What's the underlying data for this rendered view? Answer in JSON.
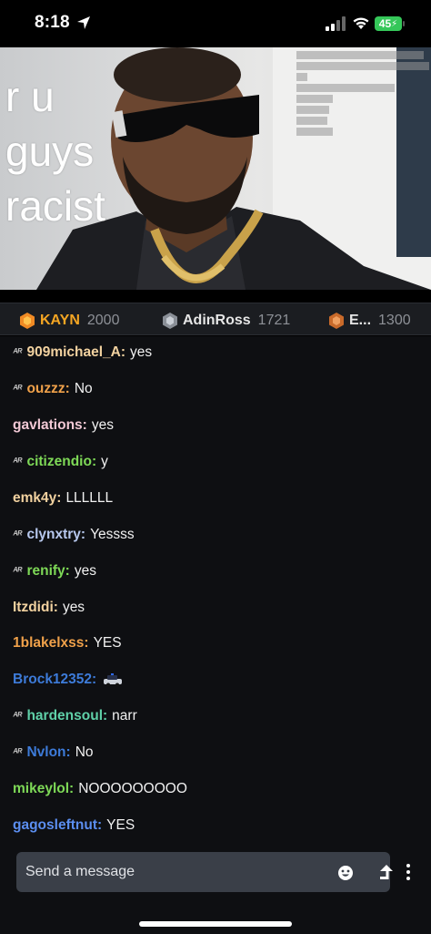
{
  "status_bar": {
    "time": "8:18",
    "battery": "45"
  },
  "stream": {
    "caption": "r u\nguys\nracist"
  },
  "leaderboard": [
    {
      "name": "KAYN",
      "score": "2000",
      "color": "#f5a623",
      "icon": "gold-gem-icon"
    },
    {
      "name": "AdinRoss",
      "score": "1721",
      "color": "#e6e6e6",
      "icon": "silver-gem-icon"
    },
    {
      "name": "E...",
      "score": "1300",
      "color": "#e6e6e6",
      "icon": "bronze-gem-icon"
    }
  ],
  "chat": {
    "messages": [
      {
        "badge": true,
        "username": "909michael_A:",
        "message": "yes",
        "color": "#f2d2a0"
      },
      {
        "badge": true,
        "username": "ouzzz:",
        "message": "No",
        "color": "#f0a14a"
      },
      {
        "badge": false,
        "username": "gavlations:",
        "message": "yes",
        "color": "#f1c8d4"
      },
      {
        "badge": true,
        "username": "citizendio:",
        "message": "y",
        "color": "#7ed957"
      },
      {
        "badge": false,
        "username": "emk4y:",
        "message": "LLLLLL",
        "color": "#f2d2a0"
      },
      {
        "badge": true,
        "username": "clynxtry:",
        "message": "Yessss",
        "color": "#b7c8ee"
      },
      {
        "badge": true,
        "username": "renify:",
        "message": "yes",
        "color": "#7ed957"
      },
      {
        "badge": false,
        "username": "Itzdidi:",
        "message": "yes",
        "color": "#f2d2a0"
      },
      {
        "badge": false,
        "username": "1blakelxss:",
        "message": "YES",
        "color": "#f0a14a"
      },
      {
        "badge": false,
        "username": "Brock12352:",
        "message": "",
        "color": "#3d7bd9",
        "emote": true
      },
      {
        "badge": true,
        "username": "hardensoul:",
        "message": "narr",
        "color": "#5fd0a8"
      },
      {
        "badge": true,
        "username": "Nvlon:",
        "message": "No",
        "color": "#3d7bd9"
      },
      {
        "badge": false,
        "username": "mikeylol:",
        "message": "NOOOOOOOOO",
        "color": "#7ed957"
      },
      {
        "badge": false,
        "username": "gagosleftnut:",
        "message": "YES",
        "color": "#5b8ef0"
      }
    ],
    "badge_text": "ᴬᴿ"
  },
  "input": {
    "placeholder": "Send a message"
  },
  "colors": {
    "background": "#0e0f12",
    "input_bg": "#3a3f48"
  }
}
